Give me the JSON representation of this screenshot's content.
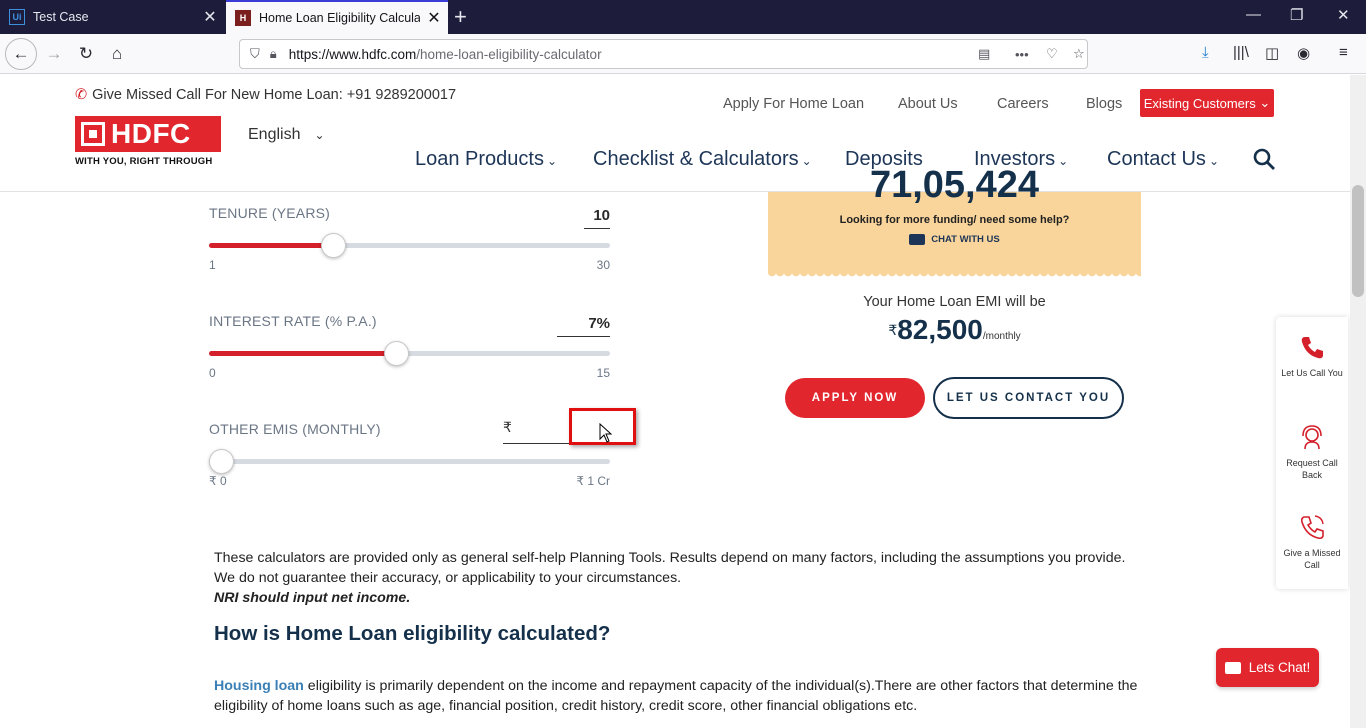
{
  "browser": {
    "tabs": [
      {
        "title": "Test Case",
        "favicon": "Ui"
      },
      {
        "title": "Home Loan Eligibility Calculato",
        "favicon": "H"
      }
    ],
    "url_domain": "https://www.hdfc.com",
    "url_path": "/home-loan-eligibility-calculator"
  },
  "header": {
    "missed_call": "Give Missed Call For New Home Loan: +91 9289200017",
    "logo_text": "HDFC",
    "logo_tagline": "WITH YOU, RIGHT THROUGH",
    "language": "English",
    "top_links": [
      "Apply For Home Loan",
      "About Us",
      "Careers",
      "Blogs"
    ],
    "existing_customers": "Existing Customers",
    "main_nav": [
      "Loan Products",
      "Checklist & Calculators",
      "Deposits",
      "Investors",
      "Contact Us"
    ]
  },
  "calculator": {
    "tenure": {
      "label": "TENURE (YEARS)",
      "value": "10",
      "min": "1",
      "max": "30",
      "fraction": 0.31
    },
    "interest": {
      "label": "INTEREST RATE (% P.A.)",
      "value": "7%",
      "min": "0",
      "max": "15",
      "fraction": 0.467
    },
    "other_emis": {
      "label": "OTHER EMIS (MONTHLY)",
      "currency": "₹",
      "value": "",
      "min": "₹ 0",
      "max": "₹ 1 Cr",
      "fraction": 0.0
    }
  },
  "result": {
    "eligible_amount": "71,05,424",
    "help_text": "Looking for more funding/ need some help?",
    "chat_with_us": "CHAT WITH US",
    "emi_label": "Your Home Loan EMI will be",
    "emi_currency": "₹",
    "emi_amount": "82,500",
    "emi_period": "/monthly",
    "apply_now": "APPLY NOW",
    "contact_you": "LET US CONTACT YOU"
  },
  "disclaimer": {
    "line1": "These calculators are provided only as general self-help Planning Tools. Results depend on many factors, including the assumptions you provide.",
    "line2": "We do not guarantee their accuracy, or applicability to your circumstances.",
    "nri": "NRI should input net income."
  },
  "section": {
    "heading": "How is Home Loan eligibility calculated?",
    "link": "Housing loan",
    "text": " eligibility is primarily dependent on the income and repayment capacity of the individual(s).There are other factors that determine the eligibility of home loans such as age, financial position, credit history, credit score, other financial obligations etc."
  },
  "side_panel": [
    "Let Us Call You",
    "Request Call Back",
    "Give a Missed Call"
  ],
  "chat_button": "Lets Chat!",
  "colors": {
    "brand_red": "#e2262e",
    "navy": "#14304a",
    "card": "#f9d59b"
  }
}
